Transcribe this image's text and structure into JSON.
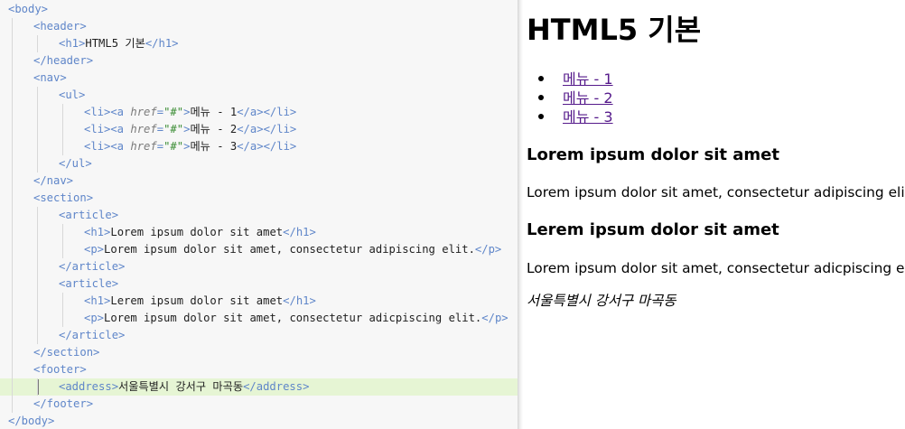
{
  "editor": {
    "lines": [
      {
        "i": 0,
        "t": [
          [
            "tg",
            "<body>"
          ]
        ]
      },
      {
        "i": 1,
        "t": [
          [
            "tg",
            "<header>"
          ]
        ]
      },
      {
        "i": 2,
        "t": [
          [
            "tg",
            "<h1>"
          ],
          [
            "tx",
            "HTML5 기본"
          ],
          [
            "tg",
            "</h1>"
          ]
        ]
      },
      {
        "i": 1,
        "t": [
          [
            "tg",
            "</header>"
          ]
        ]
      },
      {
        "i": 1,
        "t": [
          [
            "tg",
            "<nav>"
          ]
        ]
      },
      {
        "i": 2,
        "t": [
          [
            "tg",
            "<ul>"
          ]
        ]
      },
      {
        "i": 3,
        "t": [
          [
            "tg",
            "<li><a "
          ],
          [
            "at",
            "href"
          ],
          [
            "tg",
            "="
          ],
          [
            "st",
            "\"#\""
          ],
          [
            "tg",
            ">"
          ],
          [
            "tx",
            "메뉴 - 1"
          ],
          [
            "tg",
            "</a></li>"
          ]
        ]
      },
      {
        "i": 3,
        "t": [
          [
            "tg",
            "<li><a "
          ],
          [
            "at",
            "href"
          ],
          [
            "tg",
            "="
          ],
          [
            "st",
            "\"#\""
          ],
          [
            "tg",
            ">"
          ],
          [
            "tx",
            "메뉴 - 2"
          ],
          [
            "tg",
            "</a></li>"
          ]
        ]
      },
      {
        "i": 3,
        "t": [
          [
            "tg",
            "<li><a "
          ],
          [
            "at",
            "href"
          ],
          [
            "tg",
            "="
          ],
          [
            "st",
            "\"#\""
          ],
          [
            "tg",
            ">"
          ],
          [
            "tx",
            "메뉴 - 3"
          ],
          [
            "tg",
            "</a></li>"
          ]
        ]
      },
      {
        "i": 2,
        "t": [
          [
            "tg",
            "</ul>"
          ]
        ]
      },
      {
        "i": 1,
        "t": [
          [
            "tg",
            "</nav>"
          ]
        ]
      },
      {
        "i": 1,
        "t": [
          [
            "tg",
            "<section>"
          ]
        ]
      },
      {
        "i": 2,
        "t": [
          [
            "tg",
            "<article>"
          ]
        ]
      },
      {
        "i": 3,
        "t": [
          [
            "tg",
            "<h1>"
          ],
          [
            "tx",
            "Lorem ipsum dolor sit amet"
          ],
          [
            "tg",
            "</h1>"
          ]
        ]
      },
      {
        "i": 3,
        "t": [
          [
            "tg",
            "<p>"
          ],
          [
            "tx",
            "Lorem ipsum dolor sit amet, consectetur adipiscing elit."
          ],
          [
            "tg",
            "</p>"
          ]
        ]
      },
      {
        "i": 2,
        "t": [
          [
            "tg",
            "</article>"
          ]
        ]
      },
      {
        "i": 2,
        "t": [
          [
            "tg",
            "<article>"
          ]
        ]
      },
      {
        "i": 3,
        "t": [
          [
            "tg",
            "<h1>"
          ],
          [
            "tx",
            "Lerem ipsum dolor sit amet"
          ],
          [
            "tg",
            "</h1>"
          ]
        ]
      },
      {
        "i": 3,
        "t": [
          [
            "tg",
            "<p>"
          ],
          [
            "tx",
            "Lorem ipsum dolor sit amet, consectetur adicpiscing elit."
          ],
          [
            "tg",
            "</p>"
          ]
        ]
      },
      {
        "i": 2,
        "t": [
          [
            "tg",
            "</article>"
          ]
        ]
      },
      {
        "i": 1,
        "t": [
          [
            "tg",
            "</section>"
          ]
        ]
      },
      {
        "i": 1,
        "t": [
          [
            "tg",
            "<footer>"
          ]
        ]
      },
      {
        "i": 2,
        "t": [
          [
            "tg",
            "<address>"
          ],
          [
            "tx",
            "서울특별시 강서구 마곡동"
          ],
          [
            "tg",
            "</address>"
          ]
        ],
        "highlight": true
      },
      {
        "i": 1,
        "t": [
          [
            "tg",
            "</footer>"
          ]
        ]
      },
      {
        "i": 0,
        "t": [
          [
            "tg",
            "</body>"
          ]
        ]
      }
    ]
  },
  "preview": {
    "title": "HTML5 기본",
    "menu": [
      "메뉴 - 1",
      "메뉴 - 2",
      "메뉴 - 3"
    ],
    "articles": [
      {
        "heading": "Lorem ipsum dolor sit amet",
        "text": "Lorem ipsum dolor sit amet, consectetur adipiscing elit."
      },
      {
        "heading": "Lerem ipsum dolor sit amet",
        "text": "Lorem ipsum dolor sit amet, consectetur adicpiscing elit."
      }
    ],
    "address": "서울특별시 강서구 마곡동"
  },
  "colors": {
    "tag": "#5f86c9",
    "attribute": "#7a7a7a",
    "string": "#3a8c33",
    "highlight_line": "#e6f5d4",
    "link": "#551a8b"
  }
}
